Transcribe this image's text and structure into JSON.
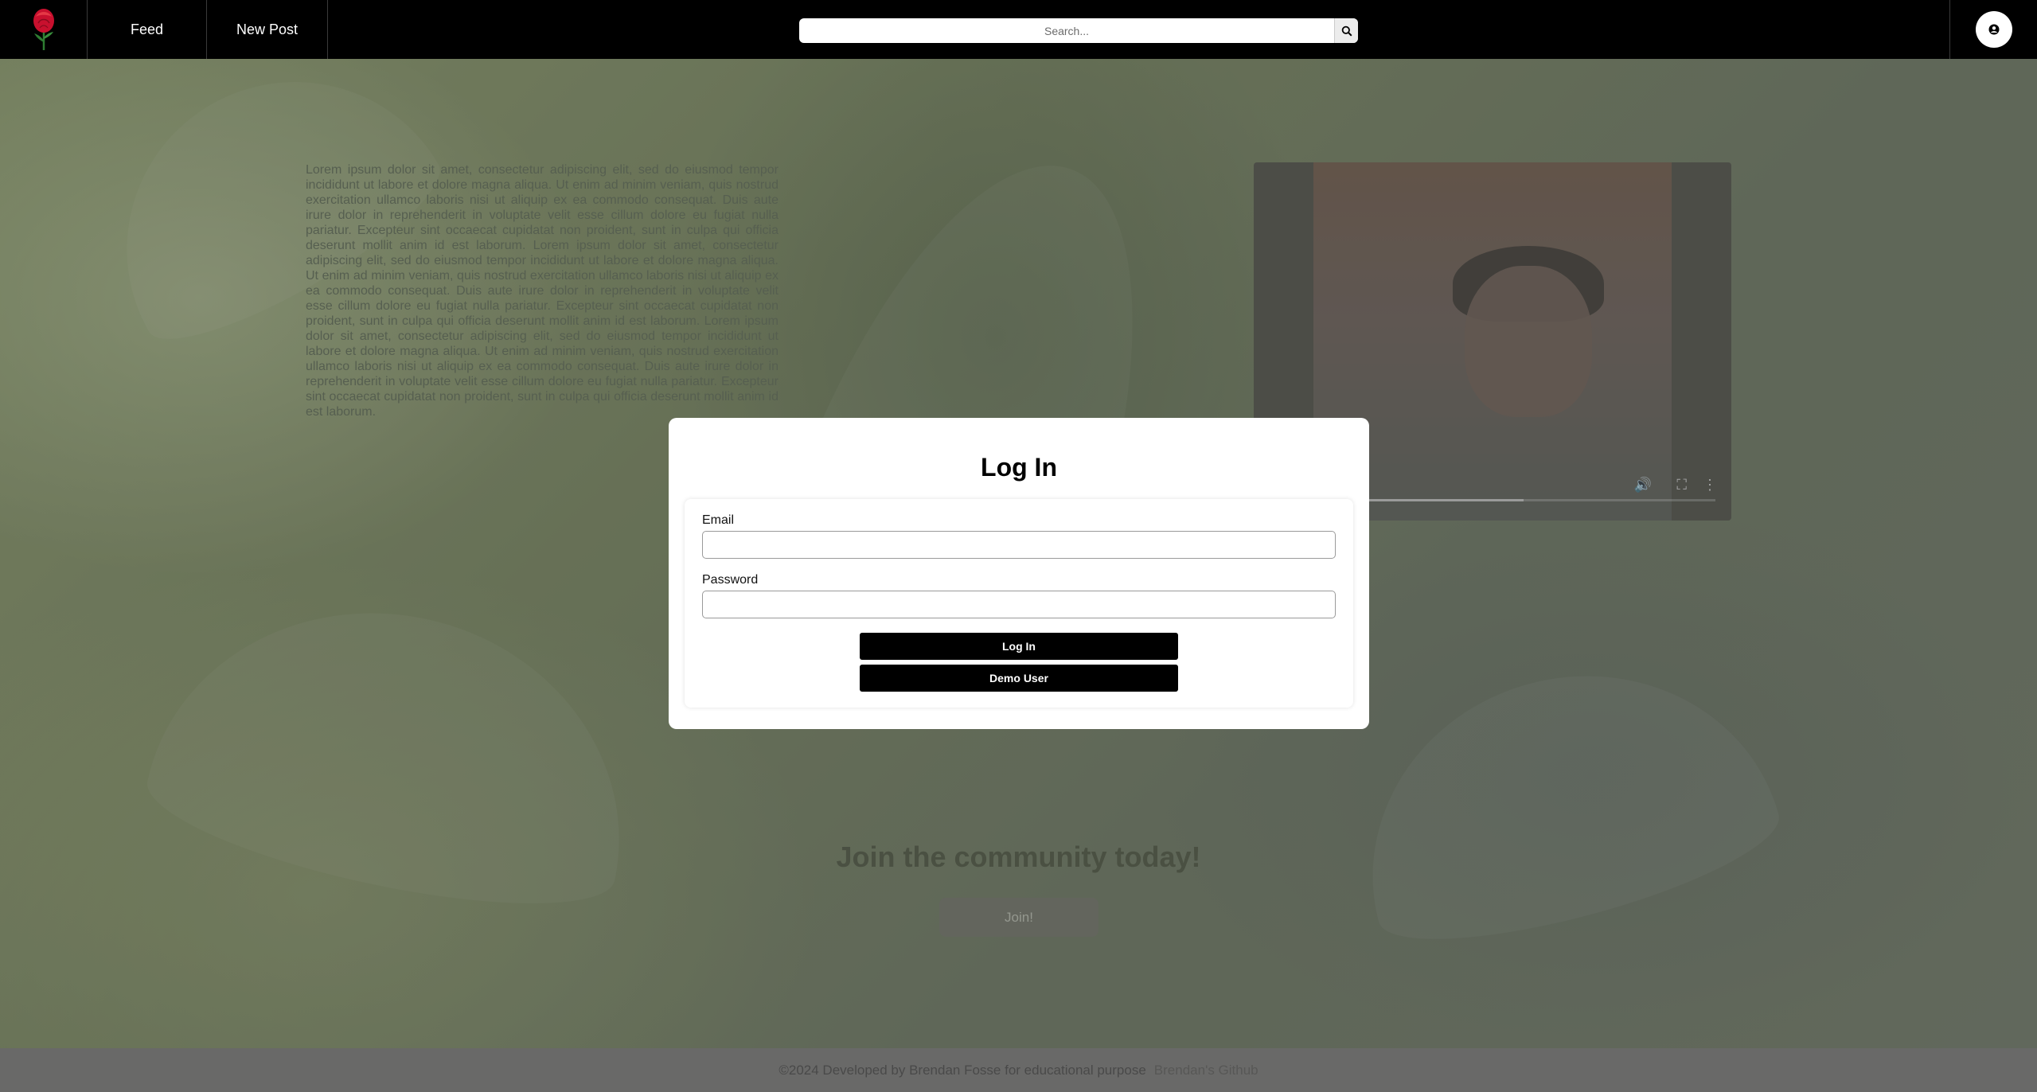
{
  "navbar": {
    "logo_name": "rose-logo",
    "links": [
      "Feed",
      "New Post"
    ],
    "search": {
      "placeholder": "Search...",
      "value": ""
    }
  },
  "hero": {
    "lorem": "Lorem ipsum dolor sit amet, consectetur adipiscing elit, sed do eiusmod tempor incididunt ut labore et dolore magna aliqua. Ut enim ad minim veniam, quis nostrud exercitation ullamco laboris nisi ut aliquip ex ea commodo consequat. Duis aute irure dolor in reprehenderit in voluptate velit esse cillum dolore eu fugiat nulla pariatur. Excepteur sint occaecat cupidatat non proident, sunt in culpa qui officia deserunt mollit anim id est laborum. Lorem ipsum dolor sit amet, consectetur adipiscing elit, sed do eiusmod tempor incididunt ut labore et dolore magna aliqua. Ut enim ad minim veniam, quis nostrud exercitation ullamco laboris nisi ut aliquip ex ea commodo consequat. Duis aute irure dolor in reprehenderit in voluptate velit esse cillum dolore eu fugiat nulla pariatur. Excepteur sint occaecat cupidatat non proident, sunt in culpa qui officia deserunt mollit anim id est laborum. Lorem ipsum dolor sit amet, consectetur adipiscing elit, sed do eiusmod tempor incididunt ut labore et dolore magna aliqua. Ut enim ad minim veniam, quis nostrud exercitation ullamco laboris nisi ut aliquip ex ea commodo consequat. Duis aute irure dolor in reprehenderit in voluptate velit esse cillum dolore eu fugiat nulla pariatur. Excepteur sint occaecat cupidatat non proident, sunt in culpa qui officia deserunt mollit anim id est laborum.",
    "video_progress": 0.57,
    "join_title": "Join the community today!",
    "join_button": "Join!"
  },
  "modal": {
    "title": "Log In",
    "email_label": "Email",
    "email_value": "",
    "password_label": "Password",
    "password_value": "",
    "login_button": "Log In",
    "demo_button": "Demo User"
  },
  "footer": {
    "text": "©2024 Developed by Brendan Fosse for educational purpose",
    "link": "Brendan's Github"
  },
  "colors": {
    "navbar": "#000000",
    "logo_rose": "#c8102e",
    "button_primary": "#000000"
  }
}
